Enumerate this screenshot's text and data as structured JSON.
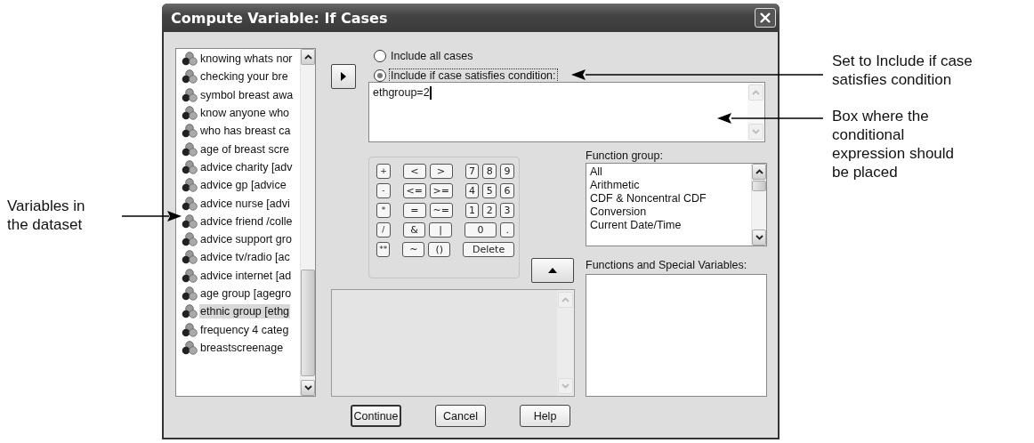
{
  "window": {
    "title": "Compute Variable: If Cases"
  },
  "variables": [
    {
      "label": "knowing whats nor",
      "selected": false
    },
    {
      "label": "checking your bre",
      "selected": false
    },
    {
      "label": "symbol breast awa",
      "selected": false
    },
    {
      "label": "know anyone who",
      "selected": false
    },
    {
      "label": "who has breast ca",
      "selected": false
    },
    {
      "label": "age of breast scre",
      "selected": false
    },
    {
      "label": "advice charity [adv",
      "selected": false
    },
    {
      "label": "advice gp [advice",
      "selected": false
    },
    {
      "label": "advice nurse [advi",
      "selected": false
    },
    {
      "label": "advice friend /colle",
      "selected": false
    },
    {
      "label": "advice support gro",
      "selected": false
    },
    {
      "label": "advice tv/radio [ac",
      "selected": false
    },
    {
      "label": "advice internet [ad",
      "selected": false
    },
    {
      "label": "age group [agegro",
      "selected": false
    },
    {
      "label": "ethnic group [ethg",
      "selected": true
    },
    {
      "label": "frequency 4 categ",
      "selected": false
    },
    {
      "label": "breastscreenage",
      "selected": false
    }
  ],
  "include_options": [
    {
      "label": "Include all cases",
      "selected": false
    },
    {
      "label": "Include if case satisfies condition:",
      "selected": true
    }
  ],
  "expression": "ethgroup=2",
  "keypad": [
    [
      {
        "key": "+",
        "kind": "small"
      },
      {
        "key": "<",
        "kind": "normal"
      },
      {
        "key": ">",
        "kind": "normal"
      },
      {
        "key": "7",
        "kind": "small"
      },
      {
        "key": "8",
        "kind": "small"
      },
      {
        "key": "9",
        "kind": "small"
      }
    ],
    [
      {
        "key": "-",
        "kind": "small"
      },
      {
        "key": "<=",
        "kind": "normal"
      },
      {
        "key": ">=",
        "kind": "normal"
      },
      {
        "key": "4",
        "kind": "small"
      },
      {
        "key": "5",
        "kind": "small"
      },
      {
        "key": "6",
        "kind": "small"
      }
    ],
    [
      {
        "key": "*",
        "kind": "small"
      },
      {
        "key": "=",
        "kind": "normal"
      },
      {
        "key": "~=",
        "kind": "normal"
      },
      {
        "key": "1",
        "kind": "small"
      },
      {
        "key": "2",
        "kind": "small"
      },
      {
        "key": "3",
        "kind": "small"
      }
    ],
    [
      {
        "key": "/",
        "kind": "small"
      },
      {
        "key": "&",
        "kind": "normal"
      },
      {
        "key": "|",
        "kind": "normal"
      },
      {
        "key": "0",
        "kind": "wide"
      },
      {
        "key": ".",
        "kind": "small"
      }
    ],
    [
      {
        "key": "**",
        "kind": "small"
      },
      {
        "key": "~",
        "kind": "normal"
      },
      {
        "key": "()",
        "kind": "normal"
      },
      {
        "key": "Delete",
        "kind": "wider"
      }
    ]
  ],
  "function_group": {
    "label": "Function group:",
    "items": [
      "All",
      "Arithmetic",
      "CDF & Noncentral CDF",
      "Conversion",
      "Current Date/Time"
    ]
  },
  "functions_label": "Functions and Special Variables:",
  "buttons": [
    "Continue",
    "Cancel",
    "Help"
  ],
  "left_annotations": [
    "Variables in the dataset"
  ],
  "right_annotations": [
    "Set to Include if case satisfies condition",
    "Box where the conditional expression should be placed"
  ]
}
